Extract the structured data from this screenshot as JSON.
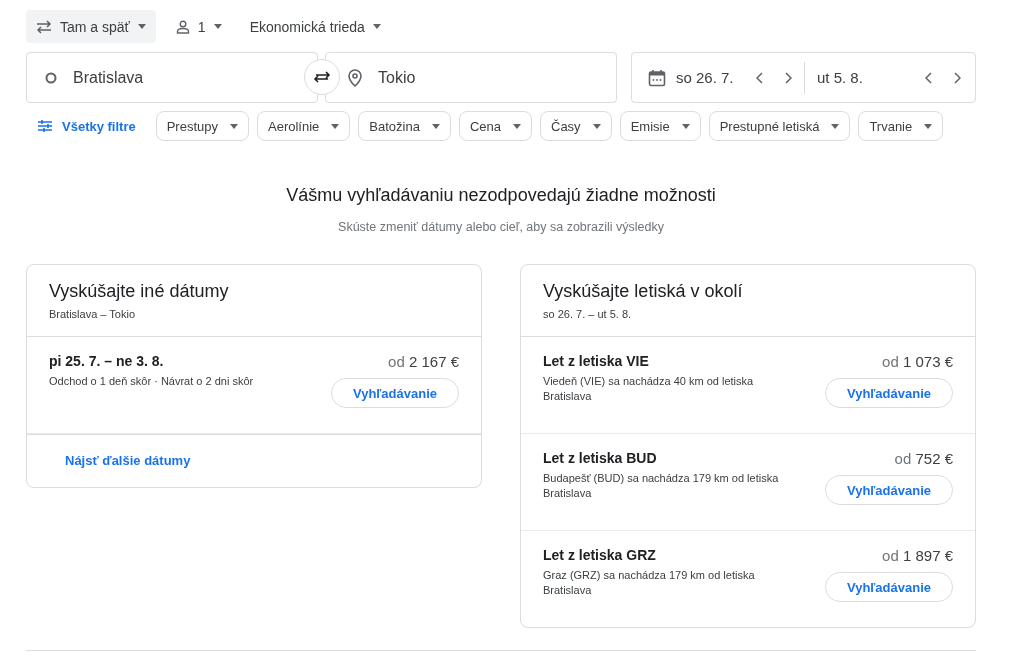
{
  "trip_options": [
    {
      "kind": "trip",
      "label": "Tam a späť"
    },
    {
      "kind": "passengers",
      "label": "1"
    },
    {
      "kind": "cabin",
      "label": "Ekonomická trieda"
    }
  ],
  "search": {
    "origin": "Bratislava",
    "destination": "Tokio",
    "departure": "so 26. 7.",
    "return": "ut 5. 8."
  },
  "filters": {
    "all_filters": "Všetky filtre",
    "chips": [
      "Prestupy",
      "Aerolínie",
      "Batožina",
      "Cena",
      "Časy",
      "Emisie",
      "Prestupné letiská",
      "Trvanie"
    ]
  },
  "empty_state": {
    "title": "Vášmu vyhľadávaniu nezodpovedajú žiadne možnosti",
    "subtitle": "Skúste zmeniť dátumy alebo cieľ, aby sa zobrazili výsledky"
  },
  "cards": [
    {
      "title": "Vyskúšajte iné dátumy",
      "subtitle": "Bratislava – Tokio",
      "items": [
        {
          "title": "pi 25. 7. – ne 3. 8.",
          "detail": "Odchod o 1 deň skôr · Návrat o 2 dni skôr",
          "price_prefix": "od",
          "price": "2 167 €",
          "button": "Vyhľadávanie"
        }
      ],
      "footer_link": "Nájsť ďalšie dátumy"
    },
    {
      "title": "Vyskúšajte letiská v okolí",
      "subtitle": "so 26. 7. – ut 5. 8.",
      "items": [
        {
          "title": "Let z letiska VIE",
          "detail": "Viedeň (VIE) sa nachádza 40 km od letiska Bratislava",
          "price_prefix": "od",
          "price": "1 073 €",
          "button": "Vyhľadávanie"
        },
        {
          "title": "Let z letiska BUD",
          "detail": "Budapešť (BUD) sa nachádza 179 km od letiska Bratislava",
          "price_prefix": "od",
          "price": "752 €",
          "button": "Vyhľadávanie"
        },
        {
          "title": "Let z letiska GRZ",
          "detail": "Graz (GRZ) sa nachádza 179 km od letiska Bratislava",
          "price_prefix": "od",
          "price": "1 897 €",
          "button": "Vyhľadávanie"
        }
      ]
    }
  ]
}
